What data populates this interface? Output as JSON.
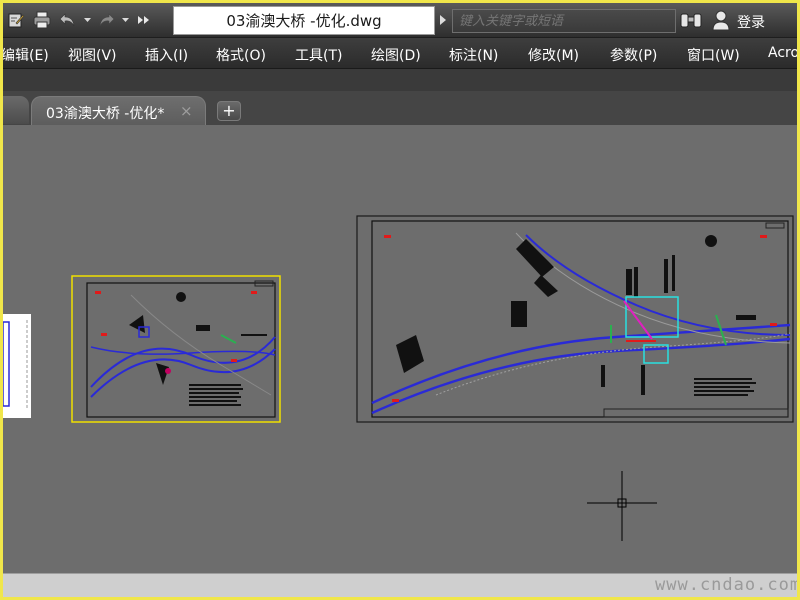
{
  "title_bar": {
    "document_title": "03渝澳大桥 -优化.dwg",
    "search_placeholder": "键入关键字或短语",
    "login_label": "登录",
    "icons": [
      "save-icon",
      "print-icon",
      "undo-icon",
      "redo-icon",
      "more-icon",
      "search-arrow-icon",
      "binoculars-icon",
      "user-icon"
    ]
  },
  "menu": {
    "items": [
      "编辑(E)",
      "视图(V)",
      "插入(I)",
      "格式(O)",
      "工具(T)",
      "绘图(D)",
      "标注(N)",
      "修改(M)",
      "参数(P)",
      "窗口(W)",
      "Acro"
    ]
  },
  "tabs": {
    "active_label": "03渝澳大桥 -优化*",
    "close_icon": "×",
    "add_icon": "+"
  },
  "watermark": "www.cndao.com",
  "colors": {
    "outer_frame": "#f0e64a",
    "canvas": "#6d6d6d",
    "road": "#2a2ad6",
    "selection": "#f0e000"
  }
}
